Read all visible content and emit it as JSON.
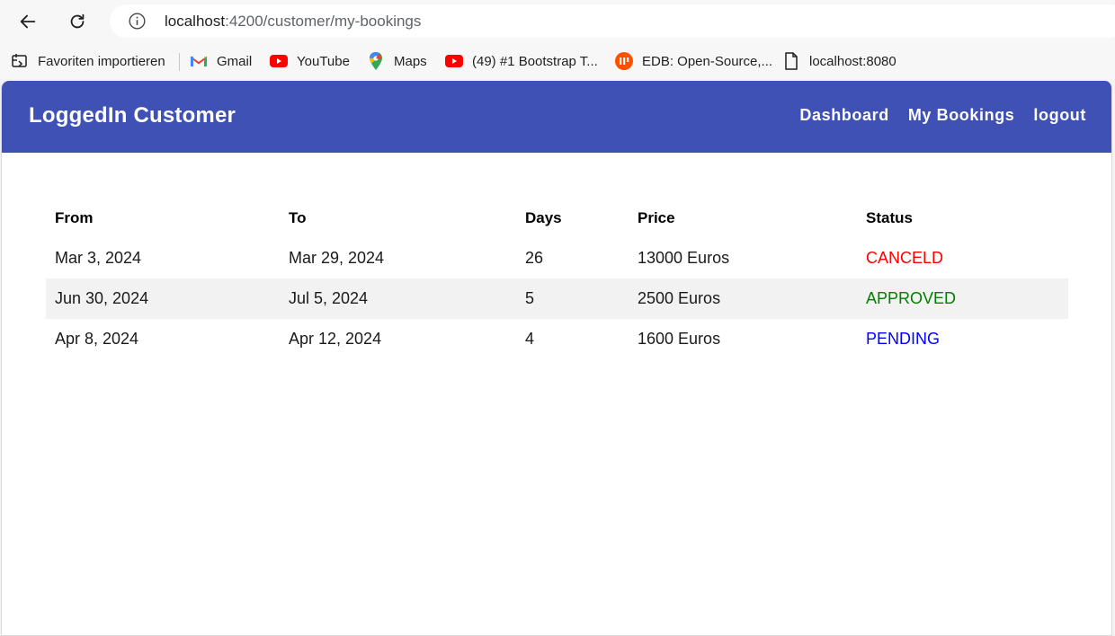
{
  "browser": {
    "url_host": "localhost",
    "url_rest": ":4200/customer/my-bookings",
    "bookmarks": [
      {
        "label": "Favoriten importieren",
        "icon": "import-icon"
      },
      {
        "label": "Gmail",
        "icon": "gmail-icon"
      },
      {
        "label": "YouTube",
        "icon": "youtube-icon"
      },
      {
        "label": "Maps",
        "icon": "maps-icon"
      },
      {
        "label": "(49) #1 Bootstrap T...",
        "icon": "youtube-icon"
      },
      {
        "label": "EDB: Open-Source,...",
        "icon": "edb-icon"
      },
      {
        "label": "localhost:8080",
        "icon": "page-icon"
      }
    ]
  },
  "toolbar": {
    "brand": "LoggedIn Customer",
    "links": [
      "Dashboard",
      "My Bookings",
      "logout"
    ],
    "color": "#3f51b5"
  },
  "table": {
    "headers": [
      "From",
      "To",
      "Days",
      "Price",
      "Status"
    ],
    "rows": [
      {
        "from": "Mar 3, 2024",
        "to": "Mar 29, 2024",
        "days": "26",
        "price": "13000 Euros",
        "status": "CANCELD"
      },
      {
        "from": "Jun 30, 2024",
        "to": "Jul 5, 2024",
        "days": "5",
        "price": "2500 Euros",
        "status": "APPROVED"
      },
      {
        "from": "Apr 8, 2024",
        "to": "Apr 12, 2024",
        "days": "4",
        "price": "1600 Euros",
        "status": "PENDING"
      }
    ],
    "status_colors": {
      "CANCELD": "#ff0000",
      "APPROVED": "#008000",
      "PENDING": "#0000ff"
    }
  }
}
